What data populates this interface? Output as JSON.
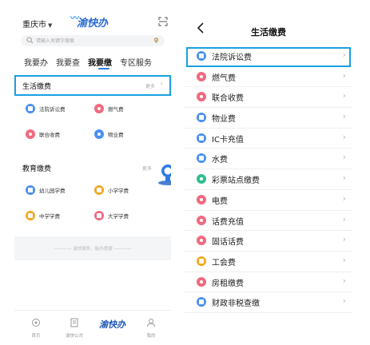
{
  "left": {
    "city": "重庆市",
    "logo": "渝快办",
    "search_placeholder": "请输入关键字搜索",
    "tabs": [
      "我要办",
      "我要查",
      "我要缴",
      "专区服务"
    ],
    "active_tab": 2,
    "section_life": {
      "title": "生活缴费",
      "more": "更多"
    },
    "life_items": [
      {
        "label": "法院诉讼费",
        "color": "#4a8ff0"
      },
      {
        "label": "燃气费",
        "color": "#f06a7e"
      },
      {
        "label": "联合收费",
        "color": "#f06a7e"
      },
      {
        "label": "物业费",
        "color": "#4a8ff0"
      }
    ],
    "section_edu": {
      "title": "教育缴费",
      "more": "更多"
    },
    "edu_items": [
      {
        "label": "幼儿园学费",
        "color": "#4a8ff0"
      },
      {
        "label": "小学学费",
        "color": "#f5a623"
      },
      {
        "label": "中学学费",
        "color": "#f5a623"
      },
      {
        "label": "大学学费",
        "color": "#f06a7e"
      }
    ],
    "banner_text": "———— 渝快服务，能办便捷 ————",
    "tabbar": [
      {
        "label": "首页",
        "icon": "home-icon"
      },
      {
        "label": "渝快公共",
        "icon": "document-icon"
      },
      {
        "label": "我的",
        "icon": "user-icon"
      }
    ],
    "tabbar_center": "渝快办"
  },
  "right": {
    "title": "生活缴费",
    "items": [
      {
        "label": "法院诉讼费",
        "color": "blue"
      },
      {
        "label": "燃气费",
        "color": "pink"
      },
      {
        "label": "联合收费",
        "color": "pink"
      },
      {
        "label": "物业费",
        "color": "blue"
      },
      {
        "label": "IC卡充值",
        "color": "blue"
      },
      {
        "label": "水费",
        "color": "blue"
      },
      {
        "label": "彩票站点缴费",
        "color": "green"
      },
      {
        "label": "电费",
        "color": "pink"
      },
      {
        "label": "话费充值",
        "color": "pink"
      },
      {
        "label": "固话话费",
        "color": "pink"
      },
      {
        "label": "工会费",
        "color": "orange"
      },
      {
        "label": "房租缴费",
        "color": "pink"
      },
      {
        "label": "财政非税查缴",
        "color": "blue"
      }
    ]
  }
}
